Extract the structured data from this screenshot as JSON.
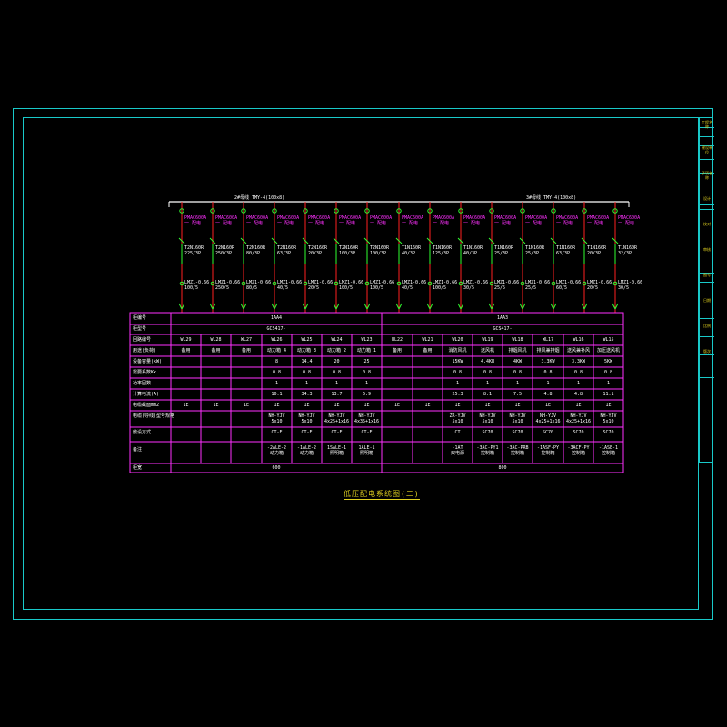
{
  "drawing": {
    "busbar_left_label": "2#母线 TMY-4(100x8)",
    "busbar_right_label": "3#母线 TMY-4(100x8)",
    "caption": "低压配电系统图(二)"
  },
  "title_block": [
    "工程名称",
    "建设单位",
    "子项名称",
    "设计",
    "校对",
    "审核",
    "图号",
    "日期",
    "比例",
    "版次"
  ],
  "feeders": [
    {
      "tag": "PMAC600A\n一 配电",
      "breaker": "T2N160R\n225/3P",
      "ct": "LMZ1-0.66\n100/5"
    },
    {
      "tag": "PMAC600A\n一 配电",
      "breaker": "T2N160R\n250/3P",
      "ct": "LMZ1-0.66\n250/5"
    },
    {
      "tag": "PMAC600A\n一 配电",
      "breaker": "T2N160R\n80/3P",
      "ct": "LMZ1-0.66\n80/5"
    },
    {
      "tag": "PMAC600A\n一 配电",
      "breaker": "T2N160R\n63/3P",
      "ct": "LMZ1-0.66\n40/5"
    },
    {
      "tag": "PMAC600A\n一 配电",
      "breaker": "T2N160R\n20/3P",
      "ct": "LMZ1-0.66\n20/5"
    },
    {
      "tag": "PMAC600A\n一 配电",
      "breaker": "T2N160R\n100/3P",
      "ct": "LMZ1-0.66\n100/5"
    },
    {
      "tag": "PMAC600A\n一 配电",
      "breaker": "T2N160R\n100/3P",
      "ct": "LMZ1-0.66\n100/5"
    },
    {
      "tag": "PMAC600A\n一 配电",
      "breaker": "T1N160R\n40/3P",
      "ct": "LMZ1-0.66\n40/5"
    },
    {
      "tag": "PMAC600A\n一 配电",
      "breaker": "T1N160R\n125/3P",
      "ct": "LMZ1-0.66\n100/5"
    },
    {
      "tag": "PMAC600A\n一 配电",
      "breaker": "T1N160R\n40/3P",
      "ct": "LMZ1-0.66\n30/5"
    },
    {
      "tag": "PMAC600A\n一 配电",
      "breaker": "T1N160R\n25/3P",
      "ct": "LMZ1-0.66\n25/5"
    },
    {
      "tag": "PMAC600A\n一 配电",
      "breaker": "T1N160R\n25/3P",
      "ct": "LMZ1-0.66\n25/5"
    },
    {
      "tag": "PMAC600A\n一 配电",
      "breaker": "T1N160R\n63/3P",
      "ct": "LMZ1-0.66\n60/5"
    },
    {
      "tag": "PMAC600A\n一 配电",
      "breaker": "T1N160R\n20/3P",
      "ct": "LMZ1-0.66\n20/5"
    },
    {
      "tag": "PMAC600A\n一 配电",
      "breaker": "T1N160R\n32/3P",
      "ct": "LMZ1-0.66\n30/5"
    }
  ],
  "table": {
    "row_labels": [
      "柜编号",
      "柜型号",
      "回路编号",
      "用途(负荷)",
      "设备容量(kW)",
      "需要系数Kx",
      "功率因数",
      "计算电流(A)",
      "电缆截面mm2",
      "电缆(导线)型号规格",
      "敷设方式",
      "备注",
      "柜宽"
    ],
    "panel_names": [
      "1AA4",
      "1AA3"
    ],
    "panel_models": [
      "GCS417-",
      "GCS417-"
    ],
    "panel_widths": [
      "600",
      "800"
    ],
    "columns": [
      {
        "circuit": "WL29",
        "use": "备用",
        "kw": "",
        "kx": "",
        "cos": "",
        "ia": "",
        "size": "1E",
        "cable": "",
        "lay": "",
        "note": ""
      },
      {
        "circuit": "WL28",
        "use": "备用",
        "kw": "",
        "kx": "",
        "cos": "",
        "ia": "",
        "size": "1E",
        "cable": "",
        "lay": "",
        "note": ""
      },
      {
        "circuit": "WL27",
        "use": "备用",
        "kw": "",
        "kx": "",
        "cos": "",
        "ia": "",
        "size": "1E",
        "cable": "",
        "lay": "",
        "note": ""
      },
      {
        "circuit": "WL26",
        "use": "动力箱 4",
        "kw": "8",
        "kx": "0.8",
        "cos": "1",
        "ia": "10.1",
        "size": "1E",
        "cable": "NH-YJV\n5x10",
        "lay": "CT-E",
        "note": "-2ALE-2\n动力箱"
      },
      {
        "circuit": "WL25",
        "use": "动力箱 3",
        "kw": "14.4",
        "kx": "0.8",
        "cos": "1",
        "ia": "34.3",
        "size": "1E",
        "cable": "NH-YJV\n5x10",
        "lay": "CT-E",
        "note": "-1ALE-2\n动力箱"
      },
      {
        "circuit": "WL24",
        "use": "动力箱 2",
        "kw": "20",
        "kx": "0.8",
        "cos": "1",
        "ia": "13.7",
        "size": "1E",
        "cable": "NH-YJV\n4x25+1x16",
        "lay": "CT-E",
        "note": "1SALE-1\n照明箱"
      },
      {
        "circuit": "WL23",
        "use": "动力箱 1",
        "kw": "25",
        "kx": "0.8",
        "cos": "1",
        "ia": "6.9",
        "size": "1E",
        "cable": "NH-YJV\n4x35+1x16",
        "lay": "CT-E",
        "note": "1ALE-1\n照明箱"
      },
      {
        "circuit": "WL22",
        "use": "备用",
        "kw": "",
        "kx": "",
        "cos": "",
        "ia": "",
        "size": "1E",
        "cable": "",
        "lay": "",
        "note": ""
      },
      {
        "circuit": "WL21",
        "use": "备用",
        "kw": "",
        "kx": "",
        "cos": "",
        "ia": "",
        "size": "1E",
        "cable": "",
        "lay": "",
        "note": ""
      },
      {
        "circuit": "WL20",
        "use": "消防风机",
        "kw": "15KW",
        "kx": "0.8",
        "cos": "1",
        "ia": "25.3",
        "size": "1E",
        "cable": "ZR-YJV\n5x10",
        "lay": "CT",
        "note": "-1AT\n双电源"
      },
      {
        "circuit": "WL19",
        "use": "送风机",
        "kw": "4.4KW",
        "kx": "0.8",
        "cos": "1",
        "ia": "8.1",
        "size": "1E",
        "cable": "NH-YJV\n5x10",
        "lay": "SC70",
        "note": "-3AC-PY1\n控制箱"
      },
      {
        "circuit": "WL18",
        "use": "排烟风机",
        "kw": "4KW",
        "kx": "0.8",
        "cos": "1",
        "ia": "7.5",
        "size": "1E",
        "cable": "NH-YJV\n5x10",
        "lay": "SC70",
        "note": "-3AC-PRB\n控制箱"
      },
      {
        "circuit": "WL17",
        "use": "排风兼排烟",
        "kw": "3.3KW",
        "kx": "0.8",
        "cos": "1",
        "ia": "4.8",
        "size": "1E",
        "cable": "NH-YJV\n4x25+1x16",
        "lay": "SC70",
        "note": "-1ASF-PY\n控制箱"
      },
      {
        "circuit": "WL16",
        "use": "送风兼补风",
        "kw": "3.3KW",
        "kx": "0.8",
        "cos": "1",
        "ia": "4.8",
        "size": "1E",
        "cable": "NH-YJV\n4x25+1x16",
        "lay": "SC70",
        "note": "-3ACF-PY\n控制箱"
      },
      {
        "circuit": "WL15",
        "use": "加压送风机",
        "kw": "5KW",
        "kx": "0.8",
        "cos": "1",
        "ia": "11.1",
        "size": "1E",
        "cable": "NH-YJV\n5x10",
        "lay": "SC70",
        "note": "-1ASE-1\n控制箱"
      }
    ]
  },
  "colors": {
    "frame": "#19c9c9",
    "grid": "#ff30ff",
    "busbar": "#ffffff",
    "feeder_line": "#ff2020",
    "ct_line": "#30ff30",
    "caption": "#e0d020"
  }
}
